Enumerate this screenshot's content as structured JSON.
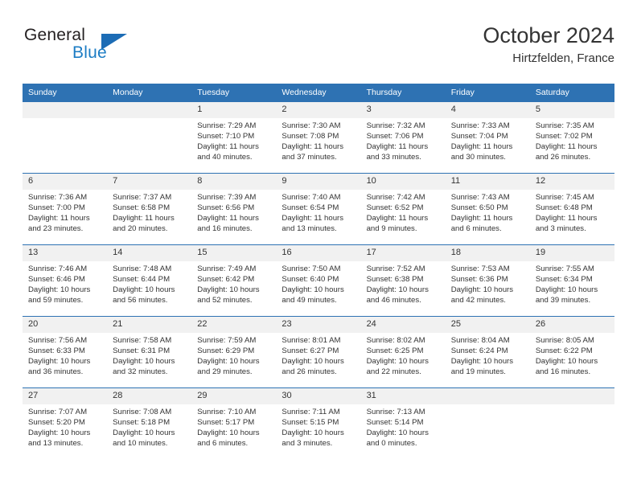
{
  "brand": {
    "word_one": "General",
    "word_two": "Blue",
    "logo_icon": "triangle-logo-icon",
    "accent_color": "#1c6cb5"
  },
  "header": {
    "title": "October 2024",
    "subtitle": "Hirtzfelden, France"
  },
  "theme": {
    "header_row_bg": "#2e72b3",
    "day_number_bg": "#f1f1f1",
    "text_color": "#333333"
  },
  "calendar": {
    "weekday_headers": [
      "Sunday",
      "Monday",
      "Tuesday",
      "Wednesday",
      "Thursday",
      "Friday",
      "Saturday"
    ],
    "labels": {
      "sunrise": "Sunrise:",
      "sunset": "Sunset:",
      "daylight": "Daylight:"
    },
    "weeks": [
      [
        {
          "day": "",
          "sunrise": "",
          "sunset": "",
          "daylight": "",
          "empty": true
        },
        {
          "day": "",
          "sunrise": "",
          "sunset": "",
          "daylight": "",
          "empty": true
        },
        {
          "day": "1",
          "sunrise": "Sunrise: 7:29 AM",
          "sunset": "Sunset: 7:10 PM",
          "daylight": "Daylight: 11 hours and 40 minutes."
        },
        {
          "day": "2",
          "sunrise": "Sunrise: 7:30 AM",
          "sunset": "Sunset: 7:08 PM",
          "daylight": "Daylight: 11 hours and 37 minutes."
        },
        {
          "day": "3",
          "sunrise": "Sunrise: 7:32 AM",
          "sunset": "Sunset: 7:06 PM",
          "daylight": "Daylight: 11 hours and 33 minutes."
        },
        {
          "day": "4",
          "sunrise": "Sunrise: 7:33 AM",
          "sunset": "Sunset: 7:04 PM",
          "daylight": "Daylight: 11 hours and 30 minutes."
        },
        {
          "day": "5",
          "sunrise": "Sunrise: 7:35 AM",
          "sunset": "Sunset: 7:02 PM",
          "daylight": "Daylight: 11 hours and 26 minutes."
        }
      ],
      [
        {
          "day": "6",
          "sunrise": "Sunrise: 7:36 AM",
          "sunset": "Sunset: 7:00 PM",
          "daylight": "Daylight: 11 hours and 23 minutes."
        },
        {
          "day": "7",
          "sunrise": "Sunrise: 7:37 AM",
          "sunset": "Sunset: 6:58 PM",
          "daylight": "Daylight: 11 hours and 20 minutes."
        },
        {
          "day": "8",
          "sunrise": "Sunrise: 7:39 AM",
          "sunset": "Sunset: 6:56 PM",
          "daylight": "Daylight: 11 hours and 16 minutes."
        },
        {
          "day": "9",
          "sunrise": "Sunrise: 7:40 AM",
          "sunset": "Sunset: 6:54 PM",
          "daylight": "Daylight: 11 hours and 13 minutes."
        },
        {
          "day": "10",
          "sunrise": "Sunrise: 7:42 AM",
          "sunset": "Sunset: 6:52 PM",
          "daylight": "Daylight: 11 hours and 9 minutes."
        },
        {
          "day": "11",
          "sunrise": "Sunrise: 7:43 AM",
          "sunset": "Sunset: 6:50 PM",
          "daylight": "Daylight: 11 hours and 6 minutes."
        },
        {
          "day": "12",
          "sunrise": "Sunrise: 7:45 AM",
          "sunset": "Sunset: 6:48 PM",
          "daylight": "Daylight: 11 hours and 3 minutes."
        }
      ],
      [
        {
          "day": "13",
          "sunrise": "Sunrise: 7:46 AM",
          "sunset": "Sunset: 6:46 PM",
          "daylight": "Daylight: 10 hours and 59 minutes."
        },
        {
          "day": "14",
          "sunrise": "Sunrise: 7:48 AM",
          "sunset": "Sunset: 6:44 PM",
          "daylight": "Daylight: 10 hours and 56 minutes."
        },
        {
          "day": "15",
          "sunrise": "Sunrise: 7:49 AM",
          "sunset": "Sunset: 6:42 PM",
          "daylight": "Daylight: 10 hours and 52 minutes."
        },
        {
          "day": "16",
          "sunrise": "Sunrise: 7:50 AM",
          "sunset": "Sunset: 6:40 PM",
          "daylight": "Daylight: 10 hours and 49 minutes."
        },
        {
          "day": "17",
          "sunrise": "Sunrise: 7:52 AM",
          "sunset": "Sunset: 6:38 PM",
          "daylight": "Daylight: 10 hours and 46 minutes."
        },
        {
          "day": "18",
          "sunrise": "Sunrise: 7:53 AM",
          "sunset": "Sunset: 6:36 PM",
          "daylight": "Daylight: 10 hours and 42 minutes."
        },
        {
          "day": "19",
          "sunrise": "Sunrise: 7:55 AM",
          "sunset": "Sunset: 6:34 PM",
          "daylight": "Daylight: 10 hours and 39 minutes."
        }
      ],
      [
        {
          "day": "20",
          "sunrise": "Sunrise: 7:56 AM",
          "sunset": "Sunset: 6:33 PM",
          "daylight": "Daylight: 10 hours and 36 minutes."
        },
        {
          "day": "21",
          "sunrise": "Sunrise: 7:58 AM",
          "sunset": "Sunset: 6:31 PM",
          "daylight": "Daylight: 10 hours and 32 minutes."
        },
        {
          "day": "22",
          "sunrise": "Sunrise: 7:59 AM",
          "sunset": "Sunset: 6:29 PM",
          "daylight": "Daylight: 10 hours and 29 minutes."
        },
        {
          "day": "23",
          "sunrise": "Sunrise: 8:01 AM",
          "sunset": "Sunset: 6:27 PM",
          "daylight": "Daylight: 10 hours and 26 minutes."
        },
        {
          "day": "24",
          "sunrise": "Sunrise: 8:02 AM",
          "sunset": "Sunset: 6:25 PM",
          "daylight": "Daylight: 10 hours and 22 minutes."
        },
        {
          "day": "25",
          "sunrise": "Sunrise: 8:04 AM",
          "sunset": "Sunset: 6:24 PM",
          "daylight": "Daylight: 10 hours and 19 minutes."
        },
        {
          "day": "26",
          "sunrise": "Sunrise: 8:05 AM",
          "sunset": "Sunset: 6:22 PM",
          "daylight": "Daylight: 10 hours and 16 minutes."
        }
      ],
      [
        {
          "day": "27",
          "sunrise": "Sunrise: 7:07 AM",
          "sunset": "Sunset: 5:20 PM",
          "daylight": "Daylight: 10 hours and 13 minutes."
        },
        {
          "day": "28",
          "sunrise": "Sunrise: 7:08 AM",
          "sunset": "Sunset: 5:18 PM",
          "daylight": "Daylight: 10 hours and 10 minutes."
        },
        {
          "day": "29",
          "sunrise": "Sunrise: 7:10 AM",
          "sunset": "Sunset: 5:17 PM",
          "daylight": "Daylight: 10 hours and 6 minutes."
        },
        {
          "day": "30",
          "sunrise": "Sunrise: 7:11 AM",
          "sunset": "Sunset: 5:15 PM",
          "daylight": "Daylight: 10 hours and 3 minutes."
        },
        {
          "day": "31",
          "sunrise": "Sunrise: 7:13 AM",
          "sunset": "Sunset: 5:14 PM",
          "daylight": "Daylight: 10 hours and 0 minutes."
        },
        {
          "day": "",
          "sunrise": "",
          "sunset": "",
          "daylight": "",
          "empty": true
        },
        {
          "day": "",
          "sunrise": "",
          "sunset": "",
          "daylight": "",
          "empty": true
        }
      ]
    ]
  }
}
